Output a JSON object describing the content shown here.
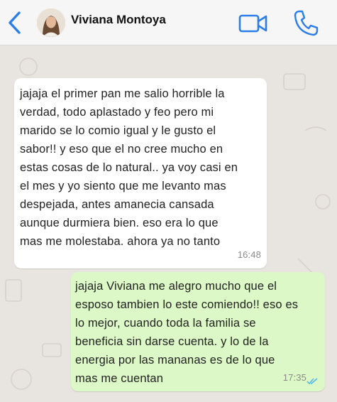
{
  "header": {
    "contact_name": "Viviana Montoya",
    "icons": {
      "back": "chevron-left-icon",
      "video": "video-camera-icon",
      "call": "phone-icon"
    },
    "accent_color": "#2b7de9"
  },
  "messages": [
    {
      "direction": "incoming",
      "text": "jajaja el primer pan me salio horrible la\nverdad, todo aplastado y feo pero mi\nmarido se lo comio igual y le gusto el\nsabor!! y eso que el no cree mucho en\nestas cosas de lo natural.. ya voy casi en\nel mes y yo siento que me levanto mas\ndespejada, antes amanecia cansada\naunque durmiera bien. eso era lo que\nmas me molestaba. ahora ya no tanto",
      "time": "16:48",
      "bubble_color": "#ffffff"
    },
    {
      "direction": "outgoing",
      "text": "jajaja Viviana me alegro mucho que el\nesposo tambien lo este comiendo!! eso es\nlo mejor, cuando toda la familia se\nbeneficia sin darse cuenta. y lo de la\nenergia por las mananas es de lo que\nmas me cuentan",
      "time": "17:35",
      "status": "read",
      "bubble_color": "#dcf8c6"
    }
  ]
}
